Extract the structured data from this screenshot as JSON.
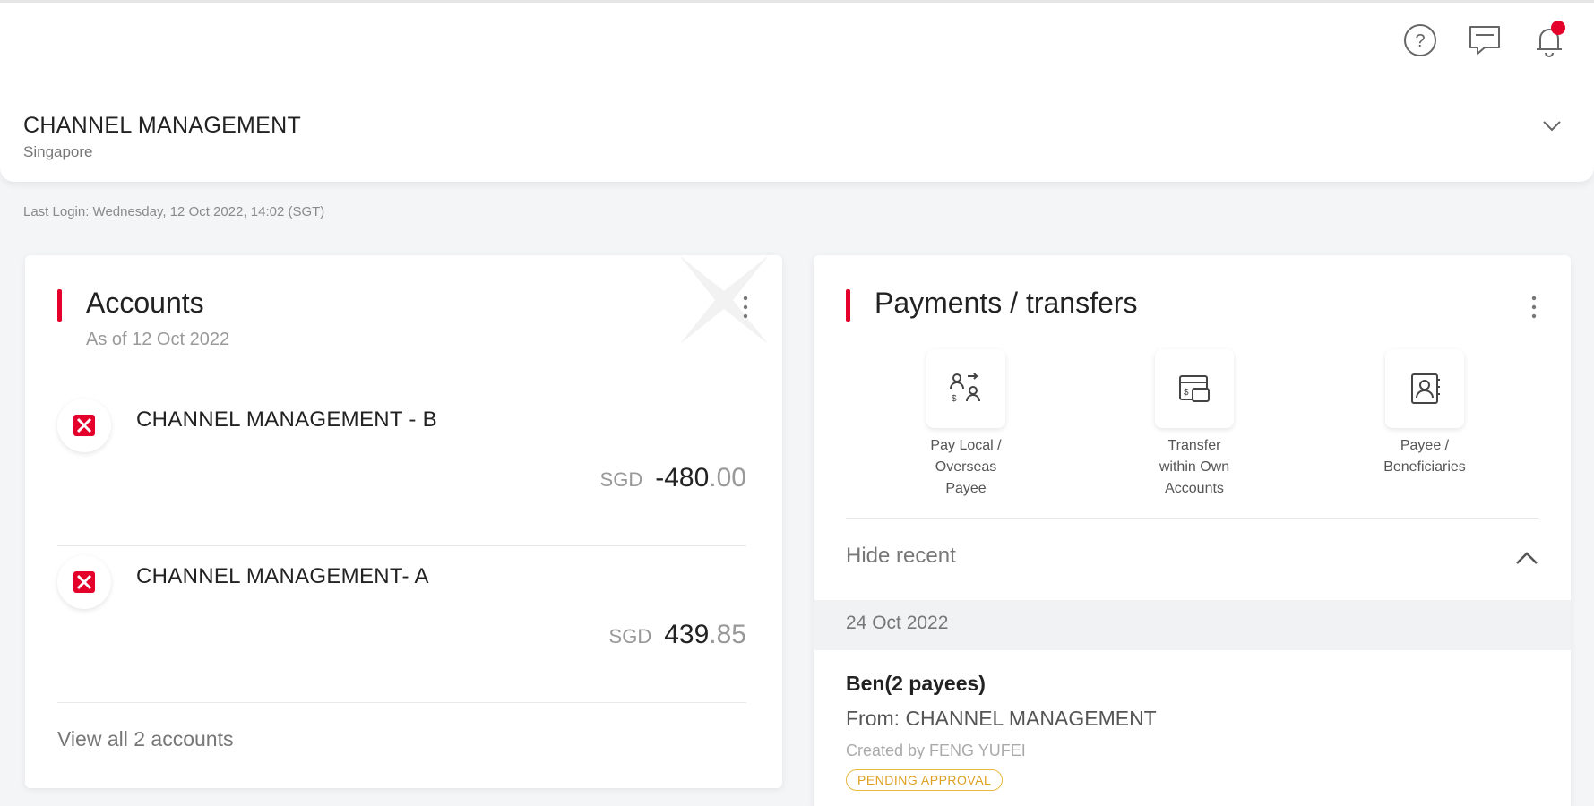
{
  "header": {
    "icons": [
      "help-icon",
      "chat-icon",
      "bell-icon"
    ],
    "notification_color": "#e4002b"
  },
  "company": {
    "name": "CHANNEL MANAGEMENT",
    "location": "Singapore"
  },
  "last_login": "Last Login: Wednesday, 12 Oct 2022, 14:02 (SGT)",
  "accounts_card": {
    "title": "Accounts",
    "subtitle": "As of 12 Oct 2022",
    "accounts": [
      {
        "name": "CHANNEL MANAGEMENT - B",
        "currency": "SGD",
        "amount_int": "-480",
        "amount_dec": ".00"
      },
      {
        "name": "CHANNEL MANAGEMENT- A",
        "currency": "SGD",
        "amount_int": "439",
        "amount_dec": ".85"
      }
    ],
    "view_all": "View all 2 accounts"
  },
  "payments_card": {
    "title": "Payments / transfers",
    "quick_actions": [
      {
        "label": "Pay Local /\nOverseas\nPayee",
        "icon": "pay-payee-icon"
      },
      {
        "label": "Transfer\nwithin Own\nAccounts",
        "icon": "transfer-own-icon"
      },
      {
        "label": "Payee /\nBeneficiaries",
        "icon": "payee-book-icon"
      }
    ],
    "hide_recent": "Hide recent",
    "recent_date": "24 Oct 2022",
    "transaction": {
      "title": "Ben(2 payees)",
      "from": "From: CHANNEL MANAGEMENT",
      "created_by": "Created by FENG YUFEI",
      "status": "PENDING APPROVAL"
    }
  },
  "colors": {
    "accent": "#e4002b",
    "badge": "#e8b93f"
  }
}
